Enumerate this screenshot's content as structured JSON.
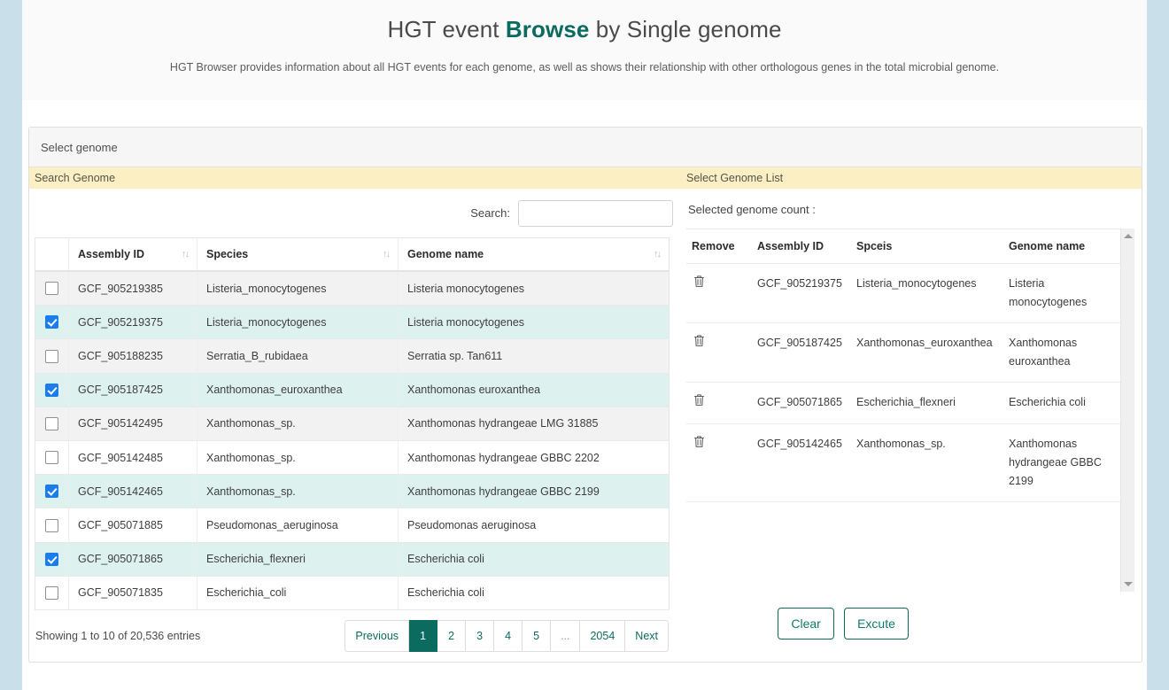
{
  "header": {
    "title_prefix": "HGT event ",
    "title_accent": "Browse",
    "title_suffix": " by Single genome",
    "subtitle": "HGT Browser provides information about all HGT events for each genome, as well as shows their relationship with other orthologous genes in the total microbial genome."
  },
  "card": {
    "head_label": "Select genome"
  },
  "left_panel": {
    "band_label": "Search Genome",
    "search_label": "Search:",
    "search_value": "",
    "search_placeholder": "",
    "columns": {
      "checkbox": "",
      "assembly_id": "Assembly ID",
      "species": "Species",
      "genome_name": "Genome name"
    },
    "rows": [
      {
        "checked": false,
        "assembly_id": "GCF_905219385",
        "species": "Listeria_monocytogenes",
        "genome_name": "Listeria monocytogenes"
      },
      {
        "checked": true,
        "assembly_id": "GCF_905219375",
        "species": "Listeria_monocytogenes",
        "genome_name": "Listeria monocytogenes"
      },
      {
        "checked": false,
        "assembly_id": "GCF_905188235",
        "species": "Serratia_B_rubidaea",
        "genome_name": "Serratia sp. Tan611"
      },
      {
        "checked": true,
        "assembly_id": "GCF_905187425",
        "species": "Xanthomonas_euroxanthea",
        "genome_name": "Xanthomonas euroxanthea"
      },
      {
        "checked": false,
        "assembly_id": "GCF_905142495",
        "species": "Xanthomonas_sp.",
        "genome_name": "Xanthomonas hydrangeae LMG 31885"
      },
      {
        "checked": false,
        "assembly_id": "GCF_905142485",
        "species": "Xanthomonas_sp.",
        "genome_name": "Xanthomonas hydrangeae GBBC 2202"
      },
      {
        "checked": true,
        "assembly_id": "GCF_905142465",
        "species": "Xanthomonas_sp.",
        "genome_name": "Xanthomonas hydrangeae GBBC 2199"
      },
      {
        "checked": false,
        "assembly_id": "GCF_905071885",
        "species": "Pseudomonas_aeruginosa",
        "genome_name": "Pseudomonas aeruginosa"
      },
      {
        "checked": true,
        "assembly_id": "GCF_905071865",
        "species": "Escherichia_flexneri",
        "genome_name": "Escherichia coli"
      },
      {
        "checked": false,
        "assembly_id": "GCF_905071835",
        "species": "Escherichia_coli",
        "genome_name": "Escherichia coli"
      }
    ],
    "showing_text": "Showing 1 to 10 of 20,536 entries",
    "pagination": {
      "previous": "Previous",
      "pages": [
        "1",
        "2",
        "3",
        "4",
        "5",
        "...",
        "2054"
      ],
      "active_page": "1",
      "next": "Next"
    }
  },
  "right_panel": {
    "band_label": "Select Genome List",
    "selected_count_label": "Selected genome count :",
    "selected_count_value": "",
    "columns": {
      "remove": "Remove",
      "assembly_id": "Assembly ID",
      "species": "Spceis",
      "genome_name": "Genome name"
    },
    "rows": [
      {
        "assembly_id": "GCF_905219375",
        "species": "Listeria_monocytogenes",
        "genome_name": "Listeria monocytogenes"
      },
      {
        "assembly_id": "GCF_905187425",
        "species": "Xanthomonas_euroxanthea",
        "genome_name": "Xanthomonas euroxanthea"
      },
      {
        "assembly_id": "GCF_905071865",
        "species": "Escherichia_flexneri",
        "genome_name": "Escherichia coli"
      },
      {
        "assembly_id": "GCF_905142465",
        "species": "Xanthomonas_sp.",
        "genome_name": "Xanthomonas hydrangeae GBBC 2199"
      }
    ],
    "clear_label": "Clear",
    "execute_label": "Excute"
  },
  "colors": {
    "accent": "#0b6b5f",
    "band": "#fcefc4",
    "selected_row": "#ddf1ee",
    "checkbox": "#1b7ced",
    "page_bg": "#c9dfea"
  }
}
